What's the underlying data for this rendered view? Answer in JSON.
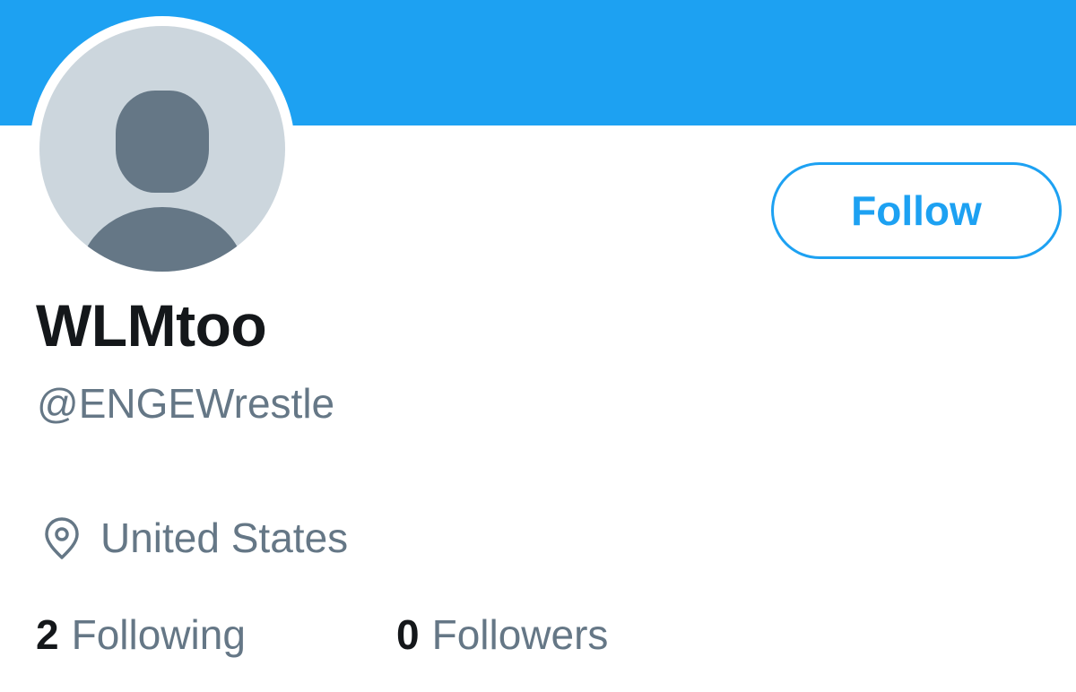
{
  "profile": {
    "display_name": "WLMtoo",
    "handle": "@ENGEWrestle",
    "location": "United States",
    "avatar": "default-avatar-silhouette-icon"
  },
  "actions": {
    "follow_label": "Follow"
  },
  "stats": {
    "following_count": "2",
    "following_label": "Following",
    "followers_count": "0",
    "followers_label": "Followers"
  },
  "icons": {
    "location": "location-pin-icon"
  },
  "colors": {
    "banner": "#1da1f2",
    "accent": "#1da1f2",
    "avatar_bg": "#ccd6dd",
    "avatar_fg": "#657786",
    "primary_text": "#14171a",
    "secondary_text": "#657786"
  }
}
